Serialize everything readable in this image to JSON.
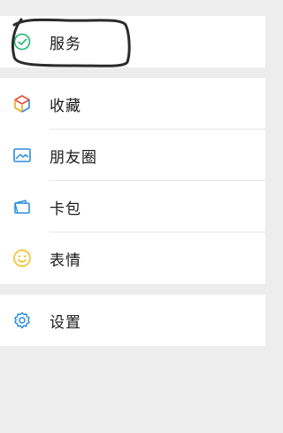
{
  "menu": {
    "section1": [
      {
        "label": "服务",
        "icon": "service-check-icon"
      }
    ],
    "section2": [
      {
        "label": "收藏",
        "icon": "favorites-cube-icon"
      },
      {
        "label": "朋友圈",
        "icon": "moments-image-icon"
      },
      {
        "label": "卡包",
        "icon": "card-wallet-icon"
      },
      {
        "label": "表情",
        "icon": "smiley-face-icon"
      }
    ],
    "section3": [
      {
        "label": "设置",
        "icon": "gear-icon"
      }
    ]
  },
  "colors": {
    "background": "#ededed",
    "service_icon": "#21b573",
    "accent_blue": "#2a8dde",
    "smiley": "#f3c431"
  }
}
